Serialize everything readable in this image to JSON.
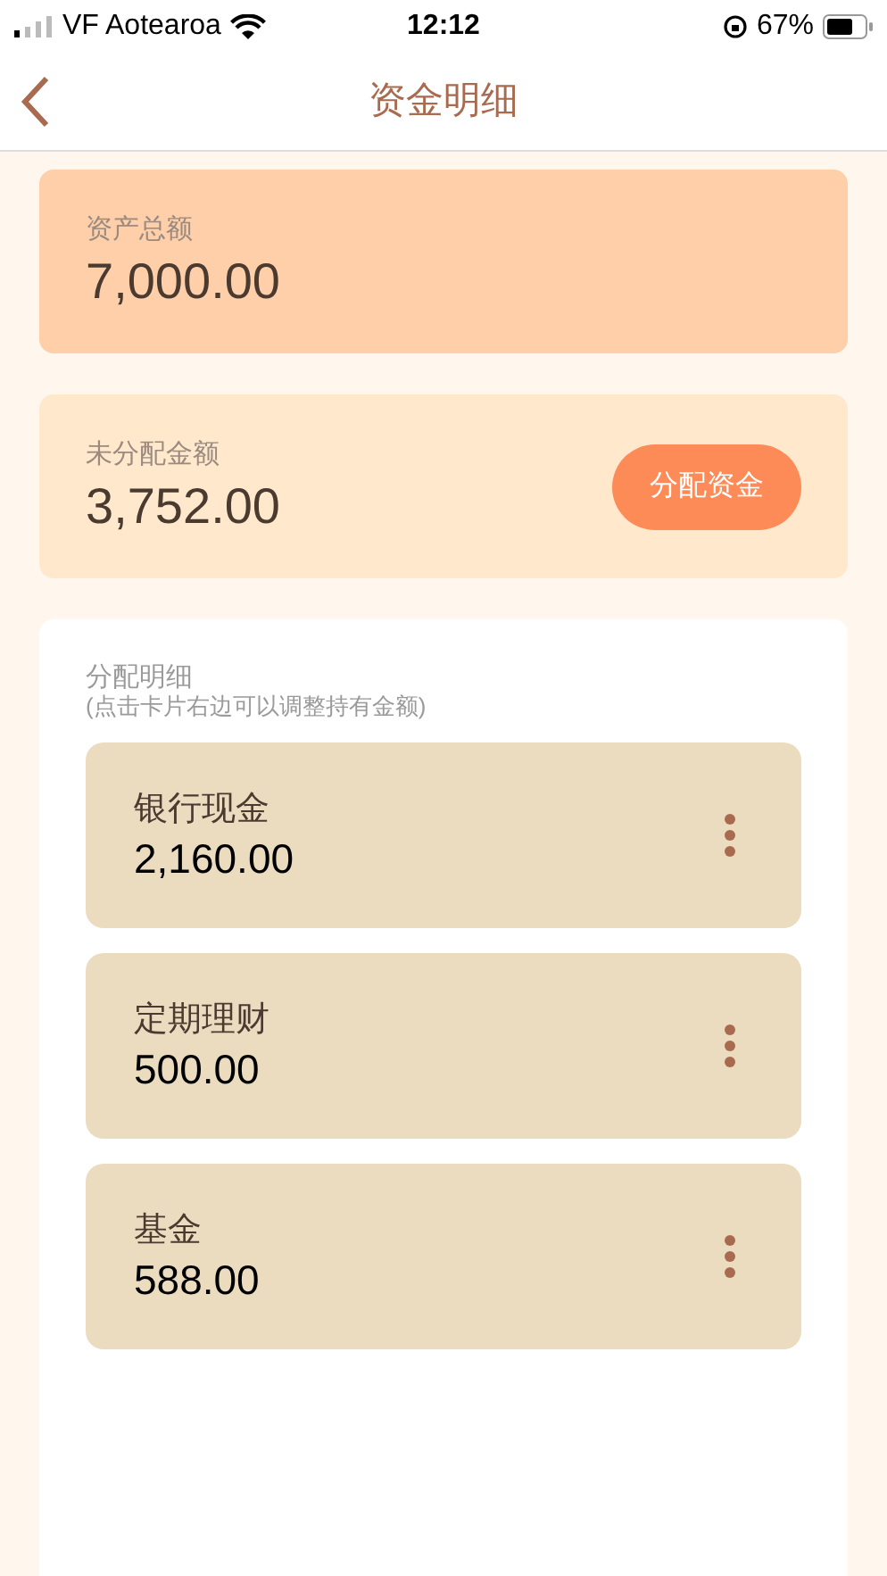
{
  "status_bar": {
    "carrier": "VF Aotearoa",
    "time": "12:12",
    "battery": "67%"
  },
  "nav": {
    "title": "资金明细"
  },
  "total": {
    "label": "资产总额",
    "amount": "7,000.00"
  },
  "unallocated": {
    "label": "未分配金额",
    "amount": "3,752.00",
    "button": "分配资金"
  },
  "allocation": {
    "title": "分配明细",
    "hint": "(点击卡片右边可以调整持有金额)",
    "items": [
      {
        "name": "银行现金",
        "amount": "2,160.00"
      },
      {
        "name": "定期理财",
        "amount": "500.00"
      },
      {
        "name": "基金",
        "amount": "588.00"
      }
    ]
  }
}
